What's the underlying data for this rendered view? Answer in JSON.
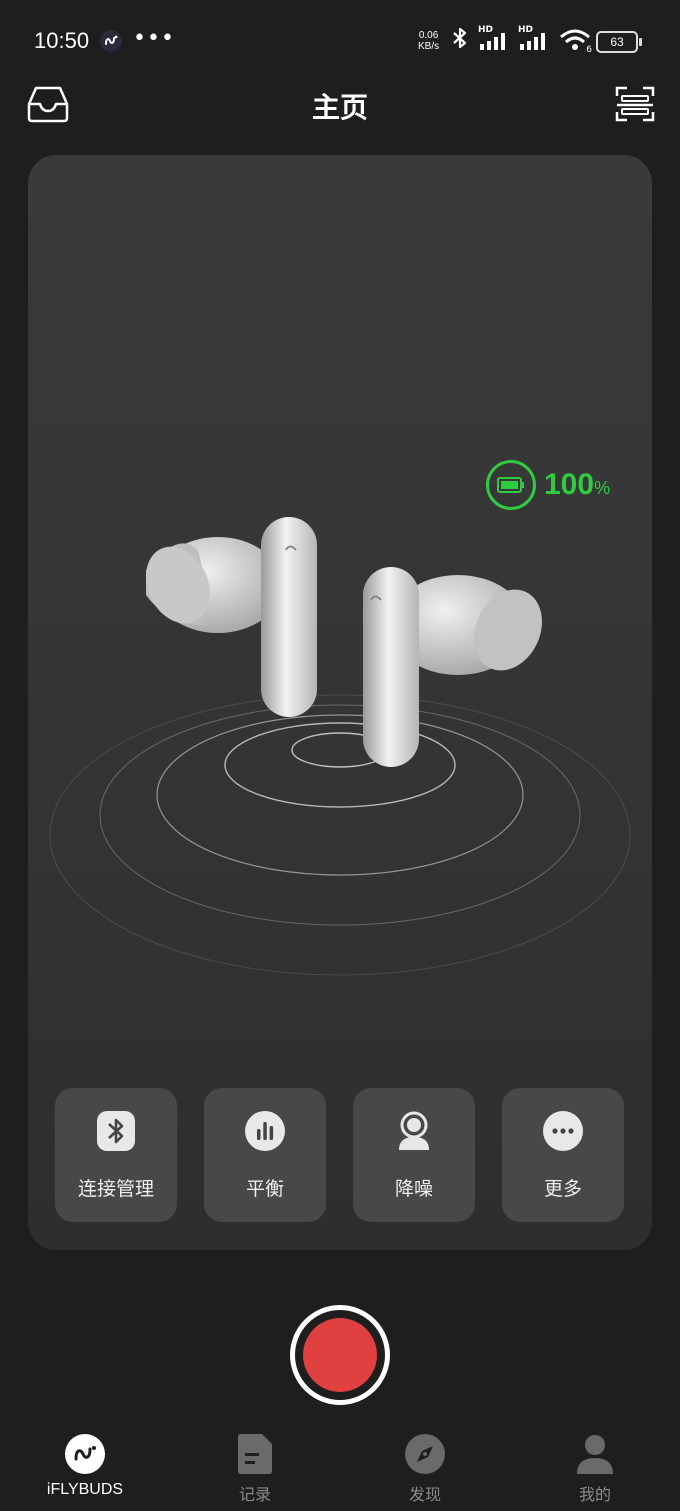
{
  "status_bar": {
    "time": "10:50",
    "net_speed_value": "0.06",
    "net_speed_unit": "KB/s",
    "battery_level": "63",
    "signal_labels": [
      "HD",
      "HD"
    ],
    "wifi_badge": "6"
  },
  "header": {
    "title": "主页"
  },
  "device": {
    "battery_value": "100",
    "battery_unit": "%",
    "battery_color": "#2ecc40"
  },
  "actions": [
    {
      "label": "连接管理",
      "icon": "bluetooth-icon"
    },
    {
      "label": "平衡",
      "icon": "equalizer-icon"
    },
    {
      "label": "降噪",
      "icon": "noise-cancel-icon"
    },
    {
      "label": "更多",
      "icon": "more-icon"
    }
  ],
  "record": {
    "color": "#e04040"
  },
  "tabs": [
    {
      "label": "iFLYBUDS",
      "icon": "iflybuds-logo-icon",
      "active": true
    },
    {
      "label": "记录",
      "icon": "document-icon",
      "active": false
    },
    {
      "label": "发现",
      "icon": "compass-icon",
      "active": false
    },
    {
      "label": "我的",
      "icon": "person-icon",
      "active": false
    }
  ]
}
